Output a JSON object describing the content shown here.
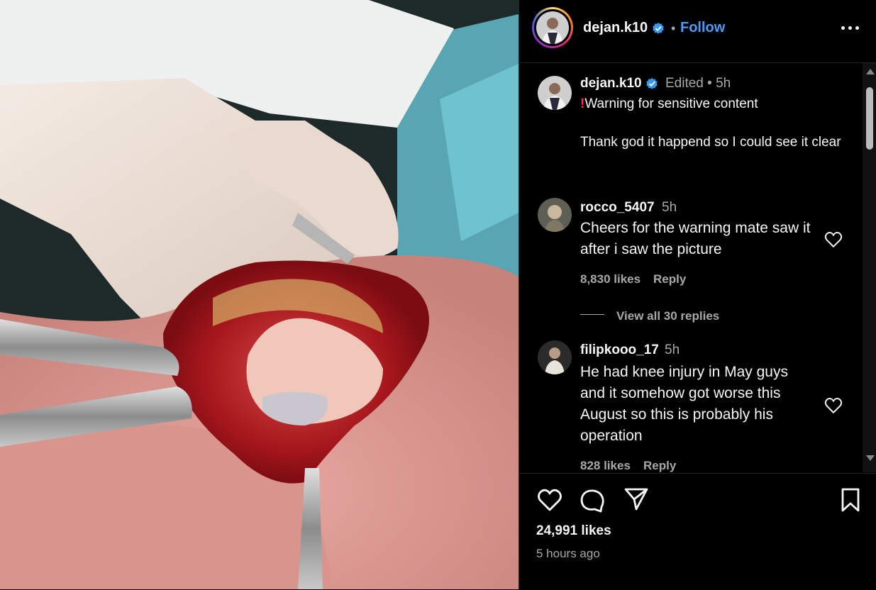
{
  "post": {
    "username": "dejan.k10",
    "follow_label": "Follow",
    "separator": "•",
    "more_label": "More options"
  },
  "caption": {
    "username": "dejan.k10",
    "meta": "Edited •  5h",
    "warning_icon": "!",
    "line1": "Warning for sensitive content",
    "line2": "Thank god it happend so I could see it clear"
  },
  "comments": [
    {
      "username": "rocco_5407",
      "time": "5h",
      "text": "Cheers for the warning mate saw it after i saw the picture",
      "likes": "8,830 likes",
      "reply_label": "Reply",
      "view_replies": "View all 30 replies"
    },
    {
      "username": "filipkooo_17",
      "time": "5h",
      "text": "He had knee injury in May guys and it somehow got worse this August so this is probably his operation",
      "likes": "828 likes",
      "reply_label": "Reply"
    }
  ],
  "footer": {
    "likes": "24,991 likes",
    "time": "5 hours ago"
  },
  "icons": [
    "verified-badge-icon",
    "more-options-icon",
    "heart-icon",
    "comment-icon",
    "share-icon",
    "bookmark-icon",
    "scroll-up-arrow-icon",
    "scroll-down-arrow-icon"
  ],
  "colors": {
    "accent": "#4a9bf5",
    "background": "#000000",
    "text": "#f5f5f5",
    "secondary": "#a8a8a8",
    "warning": "#ff3040"
  }
}
